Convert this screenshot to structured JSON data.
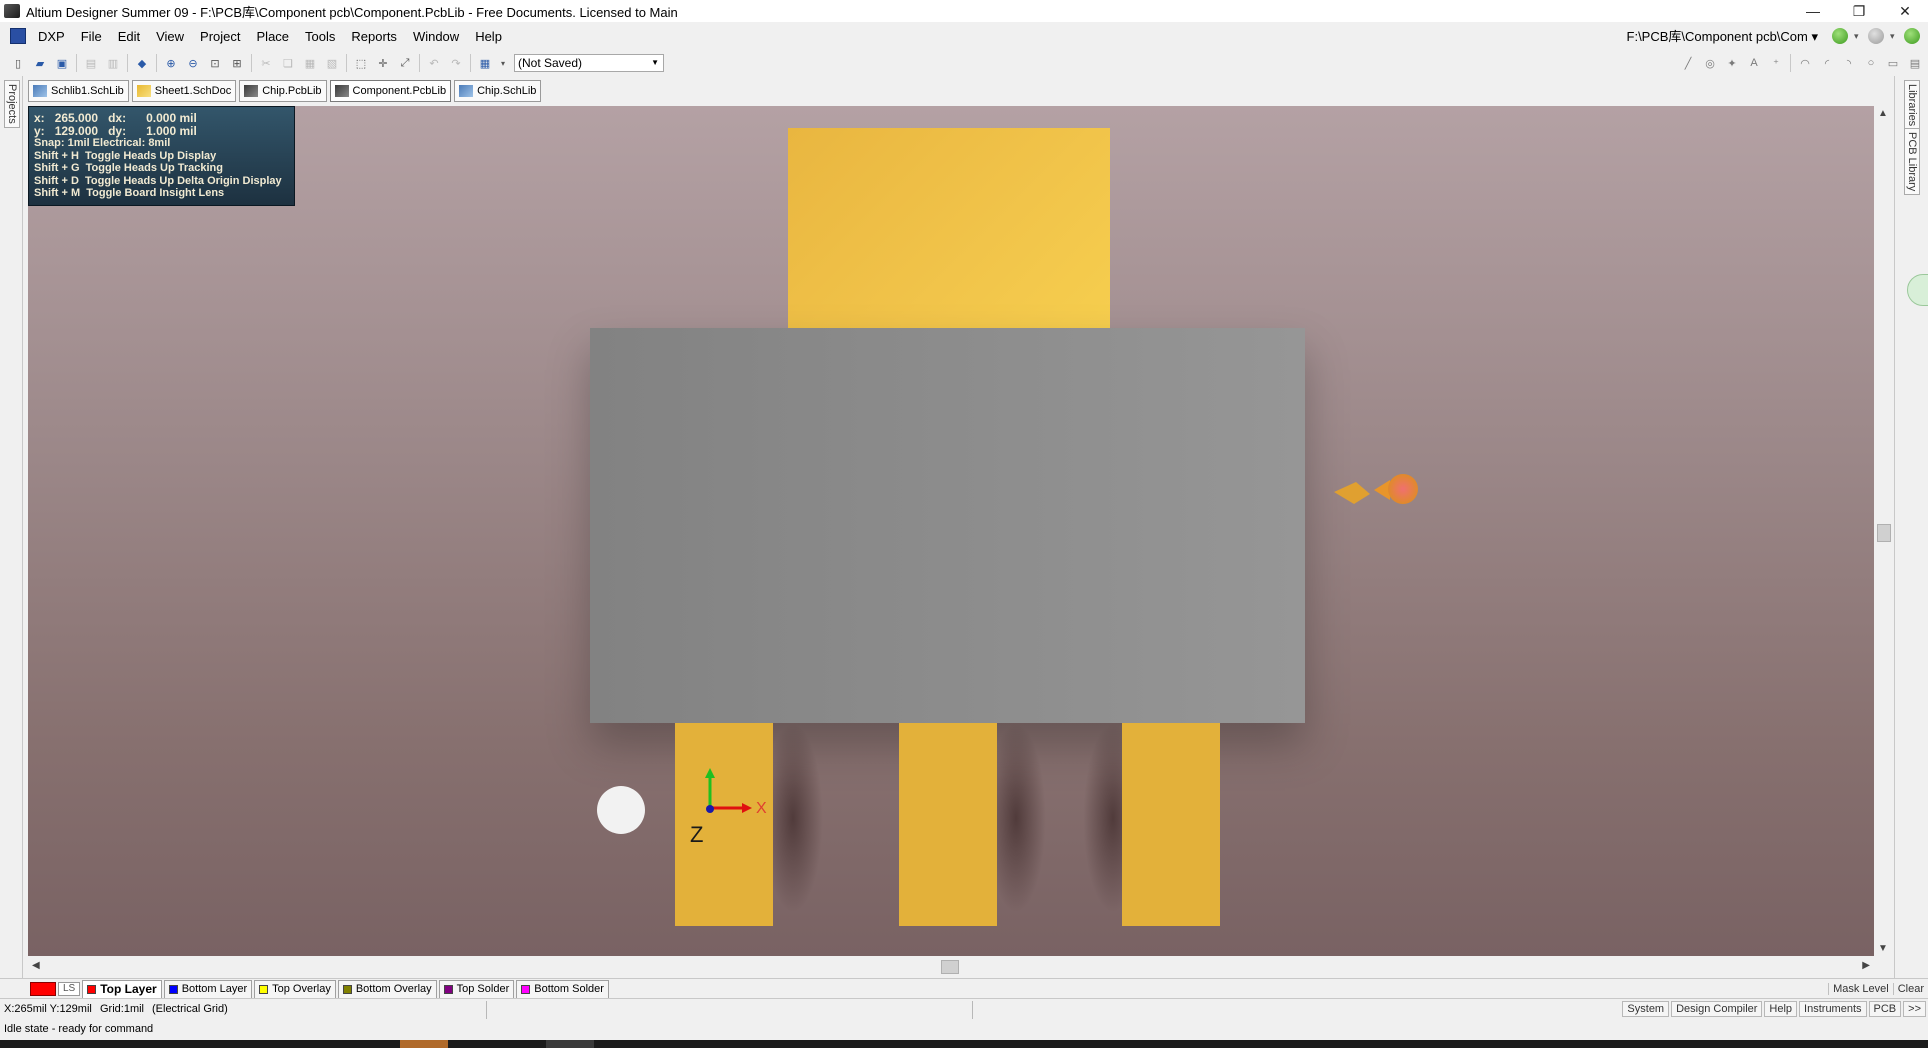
{
  "window": {
    "title": "Altium Designer Summer 09 - F:\\PCB库\\Component pcb\\Component.PcbLib - Free Documents. Licensed to Main",
    "minimize": "—",
    "restore": "❐",
    "close": "✕"
  },
  "menubar": {
    "items": [
      "DXP",
      "File",
      "Edit",
      "View",
      "Project",
      "Place",
      "Tools",
      "Reports",
      "Window",
      "Help"
    ],
    "path": "F:\\PCB库\\Component pcb\\Com ▾"
  },
  "toolbar": {
    "combo_value": "(Not Saved)"
  },
  "doc_tabs": [
    "Schlib1.SchLib",
    "Sheet1.SchDoc",
    "Chip.PcbLib",
    "Component.PcbLib",
    "Chip.SchLib"
  ],
  "side_panels": {
    "left": "Projects",
    "right_top": "Libraries",
    "right_bottom": "PCB Library"
  },
  "hud": {
    "x_label": "x:",
    "x_value": "265.000",
    "dx_label": "dx:",
    "dx_value": "0.000 mil",
    "y_label": "y:",
    "y_value": "129.000",
    "dy_label": "dy:",
    "dy_value": "1.000 mil",
    "snap": "Snap: 1mil Electrical: 8mil",
    "hints": [
      "Shift + H  Toggle Heads Up Display",
      "Shift + G  Toggle Heads Up Tracking",
      "Shift + D  Toggle Heads Up Delta Origin Display",
      "Shift + M  Toggle Board Insight Lens"
    ]
  },
  "axes": {
    "x": "X",
    "z": "Z"
  },
  "layers": {
    "ls": "LS",
    "tabs": [
      {
        "label": "Top Layer",
        "color": "#ff0000"
      },
      {
        "label": "Bottom Layer",
        "color": "#0000ff"
      },
      {
        "label": "Top Overlay",
        "color": "#ffff00"
      },
      {
        "label": "Bottom Overlay",
        "color": "#808000"
      },
      {
        "label": "Top Solder",
        "color": "#800080"
      },
      {
        "label": "Bottom Solder",
        "color": "#ff00ff"
      }
    ],
    "mask_level": "Mask Level",
    "clear": "Clear"
  },
  "status": {
    "coords": "X:265mil Y:129mil",
    "grid": "Grid:1mil",
    "electrical_grid": "(Electrical Grid)",
    "buttons": [
      "System",
      "Design Compiler",
      "Help",
      "Instruments",
      "PCB",
      ">>"
    ],
    "message": "Idle state - ready for command"
  },
  "colors": {
    "pad": "#e9b640",
    "body": "#8c8c8c",
    "canvas_top": "#b4a1a4",
    "canvas_bottom": "#796263"
  }
}
